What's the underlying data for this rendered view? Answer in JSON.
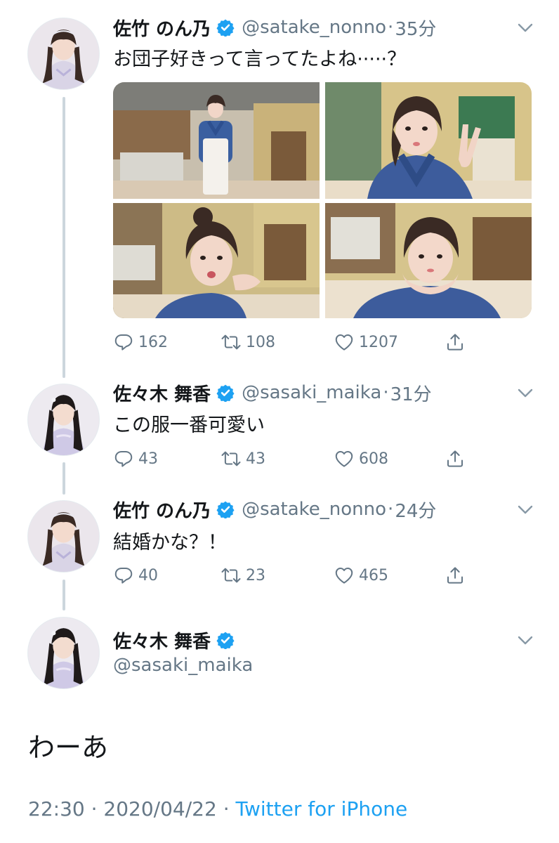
{
  "tweets": [
    {
      "name": "佐竹 のん乃",
      "handle": "@satake_nonno",
      "time": "35分",
      "text": "お団子好きって言ってたよね·····？",
      "reply_count": "162",
      "retweet_count": "108",
      "like_count": "1207"
    },
    {
      "name": "佐々木 舞香",
      "handle": "@sasaki_maika",
      "time": "31分",
      "text": "この服一番可愛い",
      "reply_count": "43",
      "retweet_count": "43",
      "like_count": "608"
    },
    {
      "name": "佐竹 のん乃",
      "handle": "@satake_nonno",
      "time": "24分",
      "text": "結婚かな？！",
      "reply_count": "40",
      "retweet_count": "23",
      "like_count": "465"
    }
  ],
  "main_tweet": {
    "name": "佐々木 舞香",
    "handle": "@sasaki_maika",
    "text": "わーあ",
    "time": "22:30",
    "date": "2020/04/22",
    "separator": "·",
    "source": "Twitter for iPhone"
  },
  "icons": {
    "verified": "verified-badge-icon",
    "reply": "reply-bubble-icon",
    "retweet": "retweet-arrows-icon",
    "like": "heart-icon",
    "share": "share-upload-icon",
    "more": "chevron-down-icon"
  },
  "colors": {
    "text": "#14171a",
    "muted": "#657786",
    "link": "#1da1f2",
    "verified": "#1da1f2",
    "thread_line": "#ccd6dd"
  }
}
